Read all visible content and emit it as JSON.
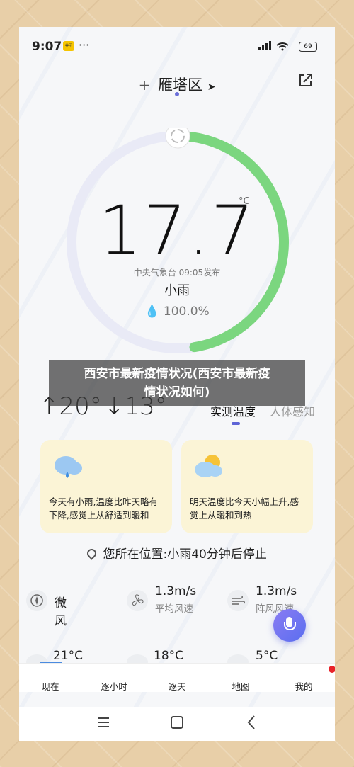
{
  "status_bar": {
    "time": "9:07",
    "app_badge": "美团",
    "more": "···",
    "network": "5G",
    "battery": "69"
  },
  "location": {
    "add": "+",
    "name": "雁塔区"
  },
  "current": {
    "temperature": "17.7",
    "unit": "°C",
    "publish": "中央气象台 09:05发布",
    "condition": "小雨",
    "humidity": "100.0%",
    "humidity_ring_fraction": 1.0
  },
  "range": {
    "high": "↑20°",
    "low": "↓13°"
  },
  "overlay": {
    "line1": "西安市最新疫情状况(西安市最新疫",
    "line2": "情状况如何)"
  },
  "tabs": {
    "measured": "实测温度",
    "feels": "人体感知"
  },
  "cards": [
    {
      "text": "今天有小雨,温度比昨天略有下降,感觉上从舒适到暖和",
      "icon": "rain-cloud-icon"
    },
    {
      "text": "明天温度比今天小幅上升,感觉上从暖和到热",
      "icon": "sun-cloud-icon"
    }
  ],
  "nowcast": "您所在位置:小雨40分钟后停止",
  "details": [
    {
      "value": "微风",
      "label": "",
      "icon": "compass-icon"
    },
    {
      "value": "1.3m/s",
      "label": "平均风速",
      "icon": "fan-icon"
    },
    {
      "value": "1.3m/s",
      "label": "阵风风速",
      "icon": "wind-icon"
    },
    {
      "value": "21°C",
      "label": "",
      "icon": "thermometer-icon"
    },
    {
      "value": "18°C",
      "label": "",
      "icon": "humidity-icon"
    },
    {
      "value": "5°C",
      "label": "",
      "icon": "dew-icon"
    }
  ],
  "bottom_nav": [
    "现在",
    "逐小时",
    "逐天",
    "地图",
    "我的"
  ],
  "colors": {
    "accent": "#5e64d6",
    "ring_green": "#7bd67f",
    "card_bg": "#fbf4d6",
    "badge_red": "#e8232a"
  }
}
